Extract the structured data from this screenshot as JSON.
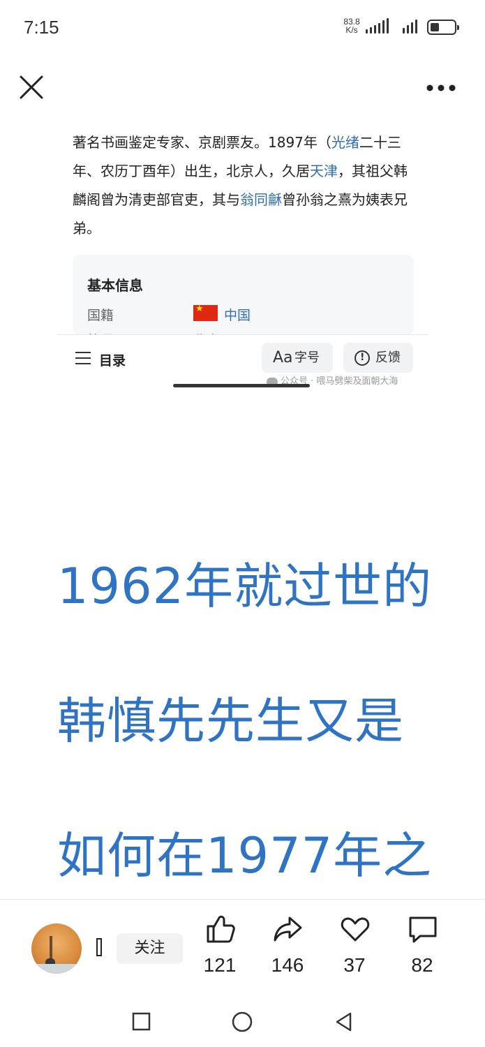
{
  "status_bar": {
    "time": "7:15",
    "net_speed_value": "83.8",
    "net_speed_unit": "K/s",
    "battery_level": 0.35
  },
  "top_bar": {
    "close_icon": "close-icon",
    "more_icon": "more-dots-icon"
  },
  "article": {
    "paragraph": [
      {
        "text": "著名书画鉴定专家、京剧票友。1897年（",
        "link": false
      },
      {
        "text": "光绪",
        "link": true
      },
      {
        "text": "二十三年、农历丁酉年）出生，北京人，久居",
        "link": false
      },
      {
        "text": "天津",
        "link": true
      },
      {
        "text": "，其祖父韩麟阁曾为清吏部官吏，其与",
        "link": false
      },
      {
        "text": "翁同龢",
        "link": true
      },
      {
        "text": "曾孙翁之熹为姨表兄弟。",
        "link": false
      }
    ],
    "info_card": {
      "title": "基本信息",
      "nationality_label": "国籍",
      "nationality_value": "中国",
      "flag_icon": "china-flag-icon",
      "next_label": "籍贯",
      "next_value": "北京"
    },
    "toolbar": {
      "toc_label": "目录",
      "font_prefix": "Aa",
      "font_label": "字号",
      "feedback_label": "反馈"
    },
    "watermark": "公众号 · 喂马劈柴及面朝大海"
  },
  "headline_lines": [
    "1962年就过世的",
    "韩慎先先生又是",
    "如何在1977年之"
  ],
  "bottom_bar": {
    "follow_label": "关注",
    "like_count": "121",
    "share_count": "146",
    "favorite_count": "37",
    "comment_count": "82"
  },
  "nav_bar": {
    "recents_icon": "square-recents-icon",
    "home_icon": "circle-home-icon",
    "back_icon": "triangle-back-icon"
  }
}
